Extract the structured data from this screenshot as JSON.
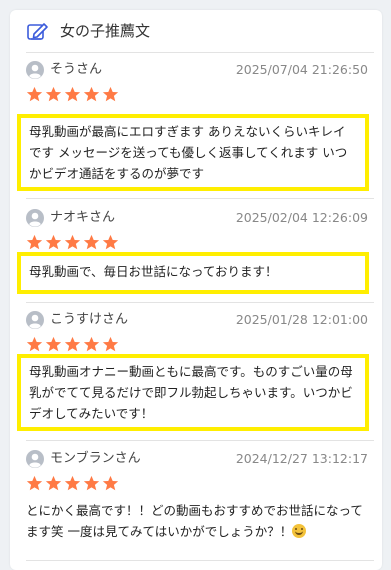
{
  "header": {
    "title": "女の子推薦文",
    "icon": "edit-icon",
    "accent_color": "#3b5bdb"
  },
  "star_color": "#ff7a45",
  "highlight_color": "#ffee00",
  "reviews": [
    {
      "name": "そうさん",
      "date": "2025/07/04 21:26:50",
      "rating": 5,
      "text": "母乳動画が最高にエロすぎます ありえないくらいキレイです メッセージを送っても優しく返事してくれます いつかビデオ通話をするのが夢です",
      "highlighted": true
    },
    {
      "name": "ナオキさん",
      "date": "2025/02/04 12:26:09",
      "rating": 5,
      "text": "母乳動画で、毎日お世話になっております！",
      "highlighted": true
    },
    {
      "name": "こうすけさん",
      "date": "2025/01/28 12:01:00",
      "rating": 5,
      "text": "母乳動画オナニー動画ともに最高です。ものすごい量の母乳がでてて見るだけで即フル勃起しちゃいます。いつかビデオしてみたいです！",
      "highlighted": true
    },
    {
      "name": "モンブランさん",
      "date": "2024/12/27 13:12:17",
      "rating": 5,
      "text": "とにかく最高です！！どの動画もおすすめでお世話になってます笑 一度は見てみてはいかがでしょうか？！",
      "emoji": "smiling-face-icon",
      "highlighted": false
    }
  ]
}
